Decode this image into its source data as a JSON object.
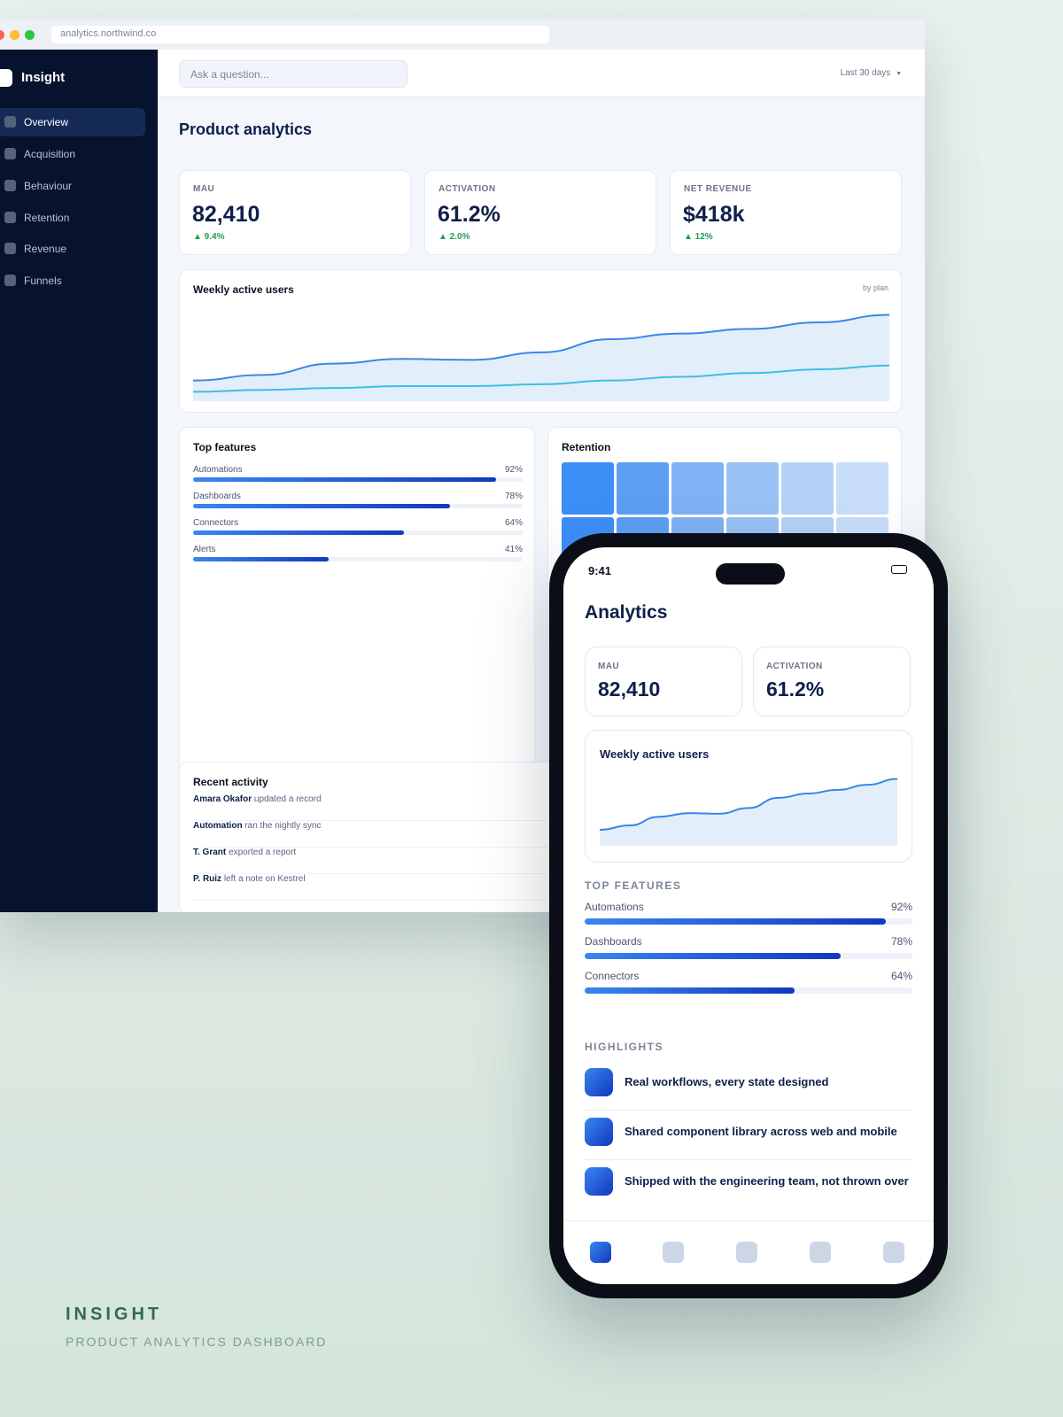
{
  "browser": {
    "url": "analytics.northwind.co"
  },
  "sidebar": {
    "brand": "Insight",
    "items": [
      {
        "label": "Overview",
        "active": true
      },
      {
        "label": "Acquisition"
      },
      {
        "label": "Behaviour"
      },
      {
        "label": "Retention"
      },
      {
        "label": "Revenue"
      },
      {
        "label": "Funnels"
      }
    ]
  },
  "topbar": {
    "search_placeholder": "Ask a question...",
    "date_range": "Last 30 days",
    "date_range_icon": "caret-down-icon"
  },
  "page": {
    "title": "Product analytics"
  },
  "kpis": [
    {
      "label": "MAU",
      "value": "82,410",
      "delta": "▲ 9.4%"
    },
    {
      "label": "ACTIVATION",
      "value": "61.2%",
      "delta": "▲ 2.0%"
    },
    {
      "label": "NET REVENUE",
      "value": "$418k",
      "delta": "▲ 12%"
    }
  ],
  "wau_chart": {
    "title": "Weekly active users",
    "note": "by plan"
  },
  "chart_data": {
    "type": "area",
    "title": "Weekly active users",
    "series": [
      {
        "values": [
          22,
          28,
          40,
          45,
          44,
          52,
          66,
          72,
          77,
          84,
          92
        ]
      },
      {
        "values": [
          10,
          12,
          14,
          16,
          16,
          18,
          22,
          26,
          30,
          34,
          38
        ]
      }
    ]
  },
  "top_features": {
    "title": "Top features",
    "items": [
      {
        "name": "Automations",
        "pct": "92%",
        "value": 0.92
      },
      {
        "name": "Dashboards",
        "pct": "78%",
        "value": 0.78
      },
      {
        "name": "Connectors",
        "pct": "64%",
        "value": 0.64
      },
      {
        "name": "Alerts",
        "pct": "41%",
        "value": 0.41
      }
    ]
  },
  "retention": {
    "title": "Retention",
    "colors": [
      "#3d8ef7",
      "#5e9ff4",
      "#7fb2f4",
      "#99c2f6",
      "#b4d2f8",
      "#c9defa"
    ]
  },
  "activity": {
    "title": "Recent activity",
    "items": [
      {
        "actor": "Amara Okafor",
        "action": "updated a record"
      },
      {
        "actor": "Automation",
        "action": "ran the nightly sync"
      },
      {
        "actor": "T. Grant",
        "action": "exported a report"
      },
      {
        "actor": "P. Ruiz",
        "action": "left a note on Kestrel"
      }
    ]
  },
  "phone": {
    "time": "9:41",
    "title": "Analytics",
    "kpis": [
      {
        "label": "MAU",
        "value": "82,410"
      },
      {
        "label": "ACTIVATION",
        "value": "61.2%"
      }
    ],
    "chart_title": "Weekly active users",
    "features_label": "TOP FEATURES",
    "features": [
      {
        "name": "Automations",
        "pct": "92%",
        "value": 0.92
      },
      {
        "name": "Dashboards",
        "pct": "78%",
        "value": 0.78
      },
      {
        "name": "Connectors",
        "pct": "64%",
        "value": 0.64
      }
    ],
    "highlights_label": "HIGHLIGHTS",
    "highlights": [
      "Real workflows, every state designed",
      "Shared component library across web and mobile",
      "Shipped with the engineering team, not thrown over"
    ],
    "tabs": [
      "home-tab",
      "tab-2",
      "tab-3",
      "tab-4",
      "tab-5"
    ]
  },
  "caption": {
    "title": "INSIGHT",
    "subtitle": "PRODUCT ANALYTICS DASHBOARD"
  },
  "colors": {
    "sidebar_bg": "#07122f",
    "accent": "#3a86f0",
    "accent_dark": "#1238c0",
    "positive": "#1f9d55",
    "caption": "#2f6b4d"
  }
}
